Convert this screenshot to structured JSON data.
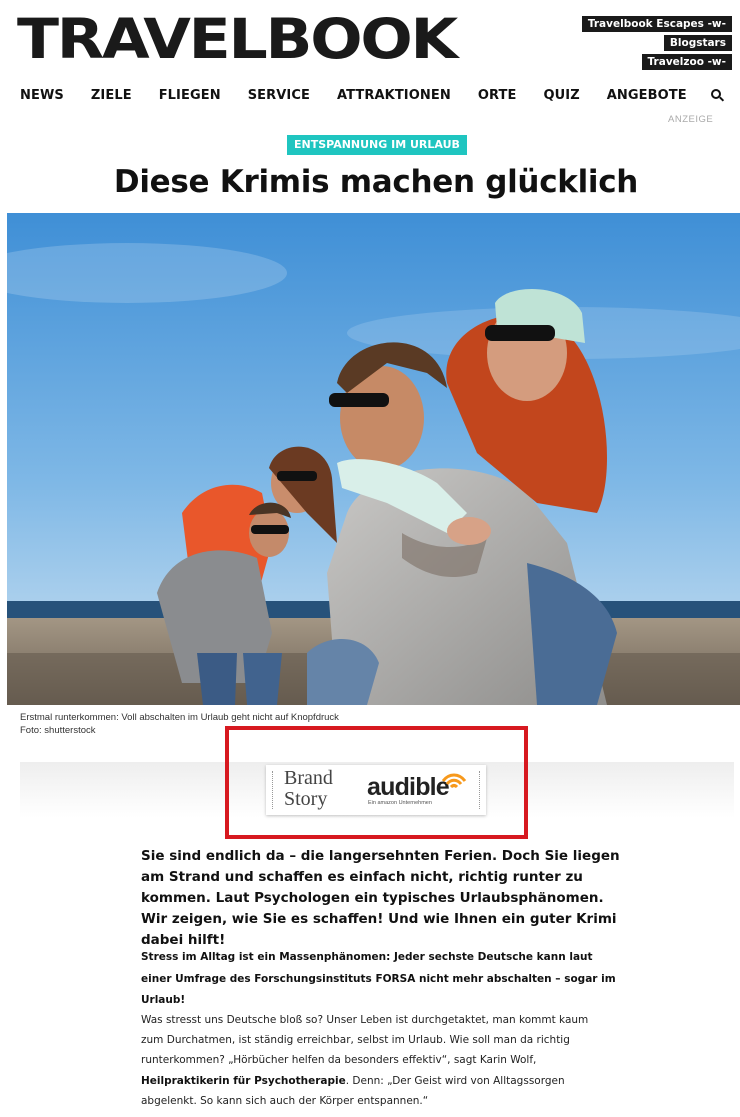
{
  "header": {
    "logo": "TRAVELBOOK",
    "external_links": [
      "Travelbook Escapes -w-",
      "Blogstars",
      "Travelzoo -w-"
    ]
  },
  "nav": {
    "items": [
      "NEWS",
      "ZIELE",
      "FLIEGEN",
      "SERVICE",
      "ATTRAKTIONEN",
      "ORTE",
      "QUIZ",
      "ANGEBOTE"
    ],
    "search_icon": "search-icon"
  },
  "ad_label": "ANZEIGE",
  "article": {
    "category": "ENTSPANNUNG IM URLAUB",
    "headline": "Diese Krimis machen glücklich",
    "image_caption": "Erstmal runterkommen: Voll abschalten im Urlaub geht nicht auf Knopfdruck",
    "image_credit": "Foto: shutterstock",
    "lead": "Sie sind endlich da – die langersehnten Ferien. Doch Sie liegen am Strand und schaffen es einfach nicht, richtig runter zu kommen. Laut Psychologen ein typisches Urlaubsphänomen. Wir zeigen, wie Sie es schaffen! Und wie Ihnen ein guter Krimi dabei hilft!",
    "intro": "Stress im Alltag ist ein Massenphänomen: Jeder sechste Deutsche kann laut einer Umfrage des Forschungsinstituts FORSA nicht mehr abschalten – sogar im Urlaub!",
    "paragraph_part1": "Was stresst uns Deutsche bloß so? Unser Leben ist durchgetaktet, man kommt kaum zum Durchatmen, ist ständig erreichbar, selbst im Urlaub. Wie soll man da richtig runterkommen? „Hörbücher helfen da besonders effektiv“, sagt Karin Wolf, ",
    "paragraph_bold": "Heilpraktikerin für Psychotherapie",
    "paragraph_part2": ". Denn: „Der Geist wird von Alltagssorgen abgelenkt. So kann sich auch der Körper entspannen.“"
  },
  "brand_story": {
    "line1": "Brand",
    "line2": "Story",
    "sponsor": "audible",
    "sponsor_sub": "Ein amazon Unternehmen"
  },
  "colors": {
    "category_bg": "#1fc5c0",
    "highlight_border": "#d71920",
    "audible_orange": "#f7991c"
  }
}
